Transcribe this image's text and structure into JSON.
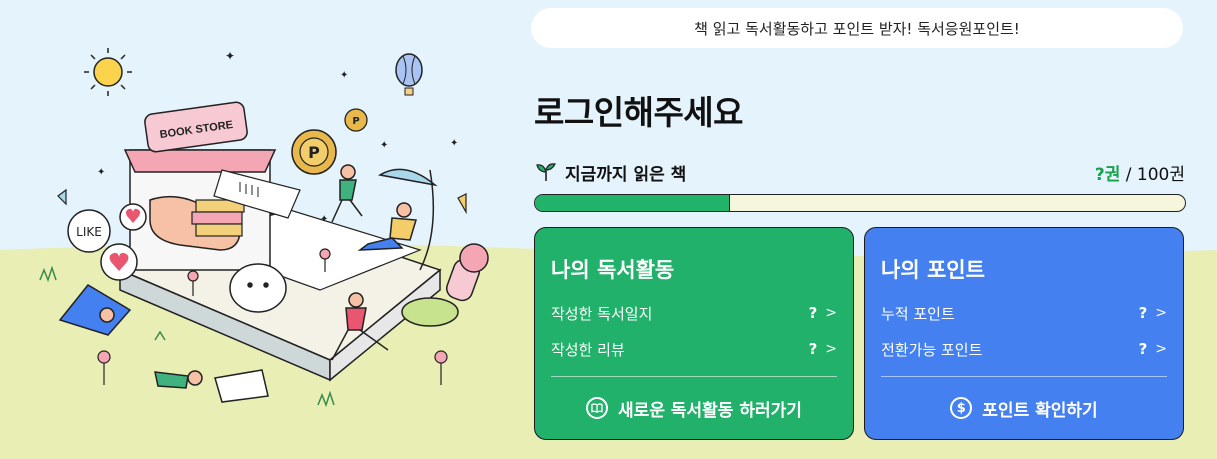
{
  "banner": {
    "text": "책 읽고 독서활동하고 포인트 받자! 독서응원포인트!"
  },
  "header": {
    "title": "로그인해주세요"
  },
  "reading": {
    "label": "지금까지 읽은 책",
    "count_value": "?권",
    "count_sep": " / ",
    "count_total": "100권",
    "progress_fraction": 0.3,
    "sprout_icon": "sprout-icon"
  },
  "illustration": {
    "sign_text": "BOOK STORE",
    "like_text": "LIKE",
    "coin_letter": "P"
  },
  "activity_card": {
    "title": "나의 독서활동",
    "rows": [
      {
        "label": "작성한 독서일지",
        "value": "?"
      },
      {
        "label": "작성한 리뷰",
        "value": "?"
      }
    ],
    "action_label": "새로운 독서활동 하러가기",
    "action_icon": "book-icon",
    "color": "#21b16b"
  },
  "points_card": {
    "title": "나의 포인트",
    "rows": [
      {
        "label": "누적 포인트",
        "value": "?"
      },
      {
        "label": "전환가능 포인트",
        "value": "?"
      }
    ],
    "action_label": "포인트 확인하기",
    "action_icon": "dollar-icon",
    "color": "#4480f0"
  },
  "colors": {
    "sky": "#e4f3fc",
    "ground": "#e9eeb4",
    "progress_fill": "#22b36a",
    "count_accent": "#16a34a"
  }
}
